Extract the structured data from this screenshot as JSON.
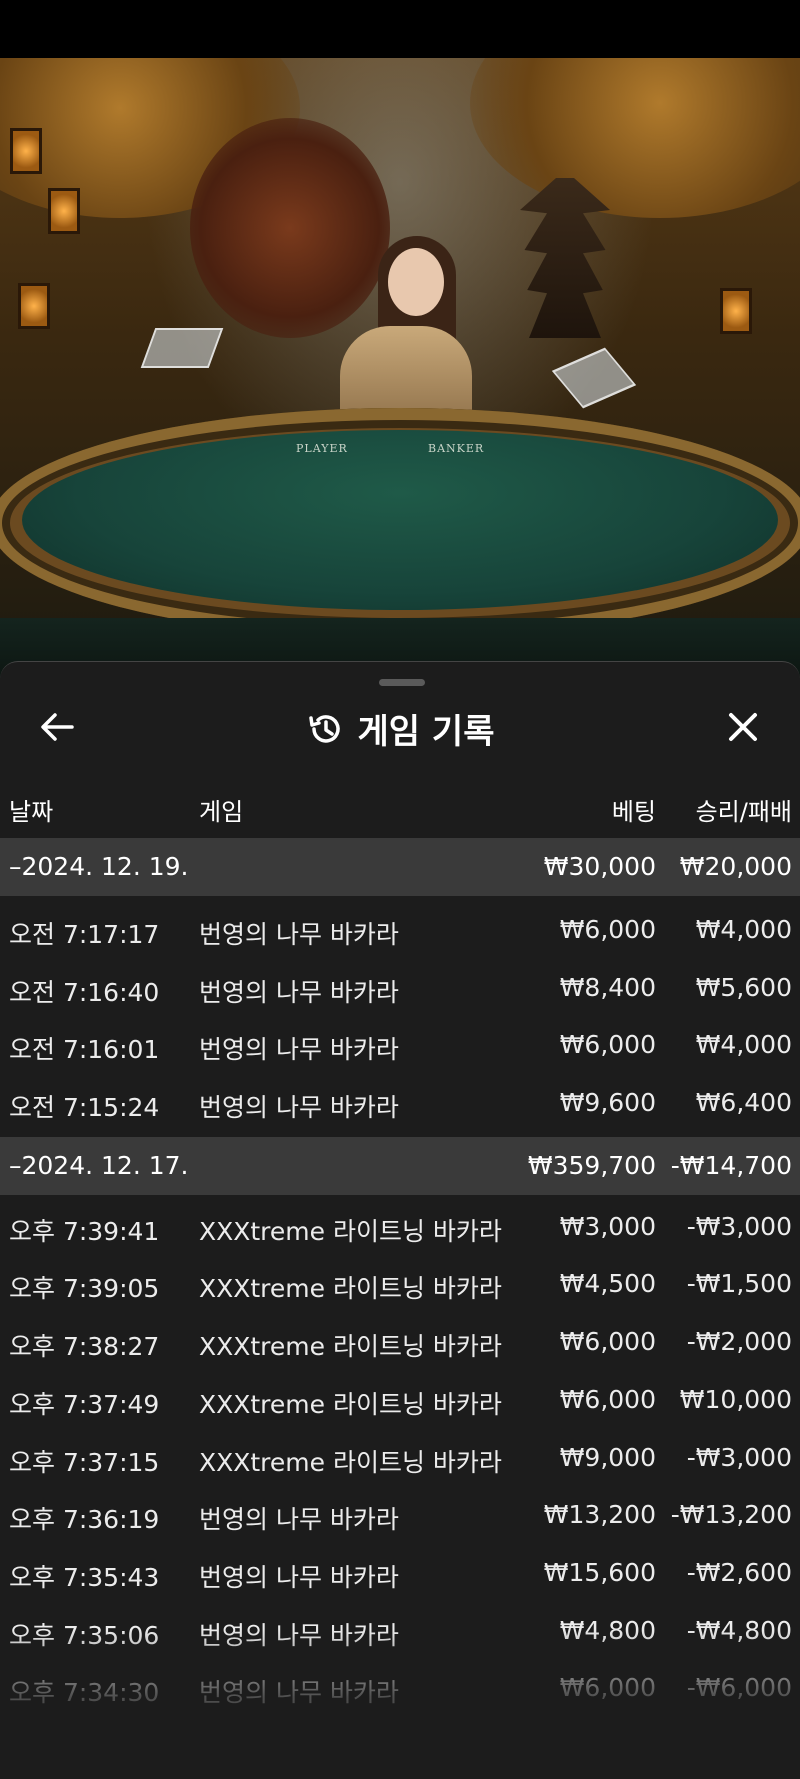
{
  "video": {
    "felt_labels": [
      "PLAYER",
      "BANKER"
    ]
  },
  "header": {
    "title": "게임 기록",
    "back_icon": "arrow-left-icon",
    "history_icon": "history-icon",
    "close_icon": "close-icon"
  },
  "columns": {
    "date": "날짜",
    "game": "게임",
    "bet": "베팅",
    "result": "승리/패배"
  },
  "groups": [
    {
      "date": "–2024. 12. 19.",
      "bet_total": "₩30,000",
      "result_total": "₩20,000",
      "rows": [
        {
          "time": "오전 7:17:17",
          "game": "번영의 나무 바카라",
          "bet": "₩6,000",
          "result": "₩4,000"
        },
        {
          "time": "오전 7:16:40",
          "game": "번영의 나무 바카라",
          "bet": "₩8,400",
          "result": "₩5,600"
        },
        {
          "time": "오전 7:16:01",
          "game": "번영의 나무 바카라",
          "bet": "₩6,000",
          "result": "₩4,000"
        },
        {
          "time": "오전 7:15:24",
          "game": "번영의 나무 바카라",
          "bet": "₩9,600",
          "result": "₩6,400"
        }
      ]
    },
    {
      "date": "–2024. 12. 17.",
      "bet_total": "₩359,700",
      "result_total": "-₩14,700",
      "rows": [
        {
          "time": "오후 7:39:41",
          "game": "XXXtreme 라이트닝 바카라",
          "bet": "₩3,000",
          "result": "-₩3,000"
        },
        {
          "time": "오후 7:39:05",
          "game": "XXXtreme 라이트닝 바카라",
          "bet": "₩4,500",
          "result": "-₩1,500"
        },
        {
          "time": "오후 7:38:27",
          "game": "XXXtreme 라이트닝 바카라",
          "bet": "₩6,000",
          "result": "-₩2,000"
        },
        {
          "time": "오후 7:37:49",
          "game": "XXXtreme 라이트닝 바카라",
          "bet": "₩6,000",
          "result": "₩10,000"
        },
        {
          "time": "오후 7:37:15",
          "game": "XXXtreme 라이트닝 바카라",
          "bet": "₩9,000",
          "result": "-₩3,000"
        },
        {
          "time": "오후 7:36:19",
          "game": "번영의 나무 바카라",
          "bet": "₩13,200",
          "result": "-₩13,200"
        },
        {
          "time": "오후 7:35:43",
          "game": "번영의 나무 바카라",
          "bet": "₩15,600",
          "result": "-₩2,600"
        },
        {
          "time": "오후 7:35:06",
          "game": "번영의 나무 바카라",
          "bet": "₩4,800",
          "result": "-₩4,800"
        },
        {
          "time": "오후 7:34:30",
          "game": "번영의 나무 바카라",
          "bet": "₩6,000",
          "result": "-₩6,000"
        }
      ]
    }
  ]
}
